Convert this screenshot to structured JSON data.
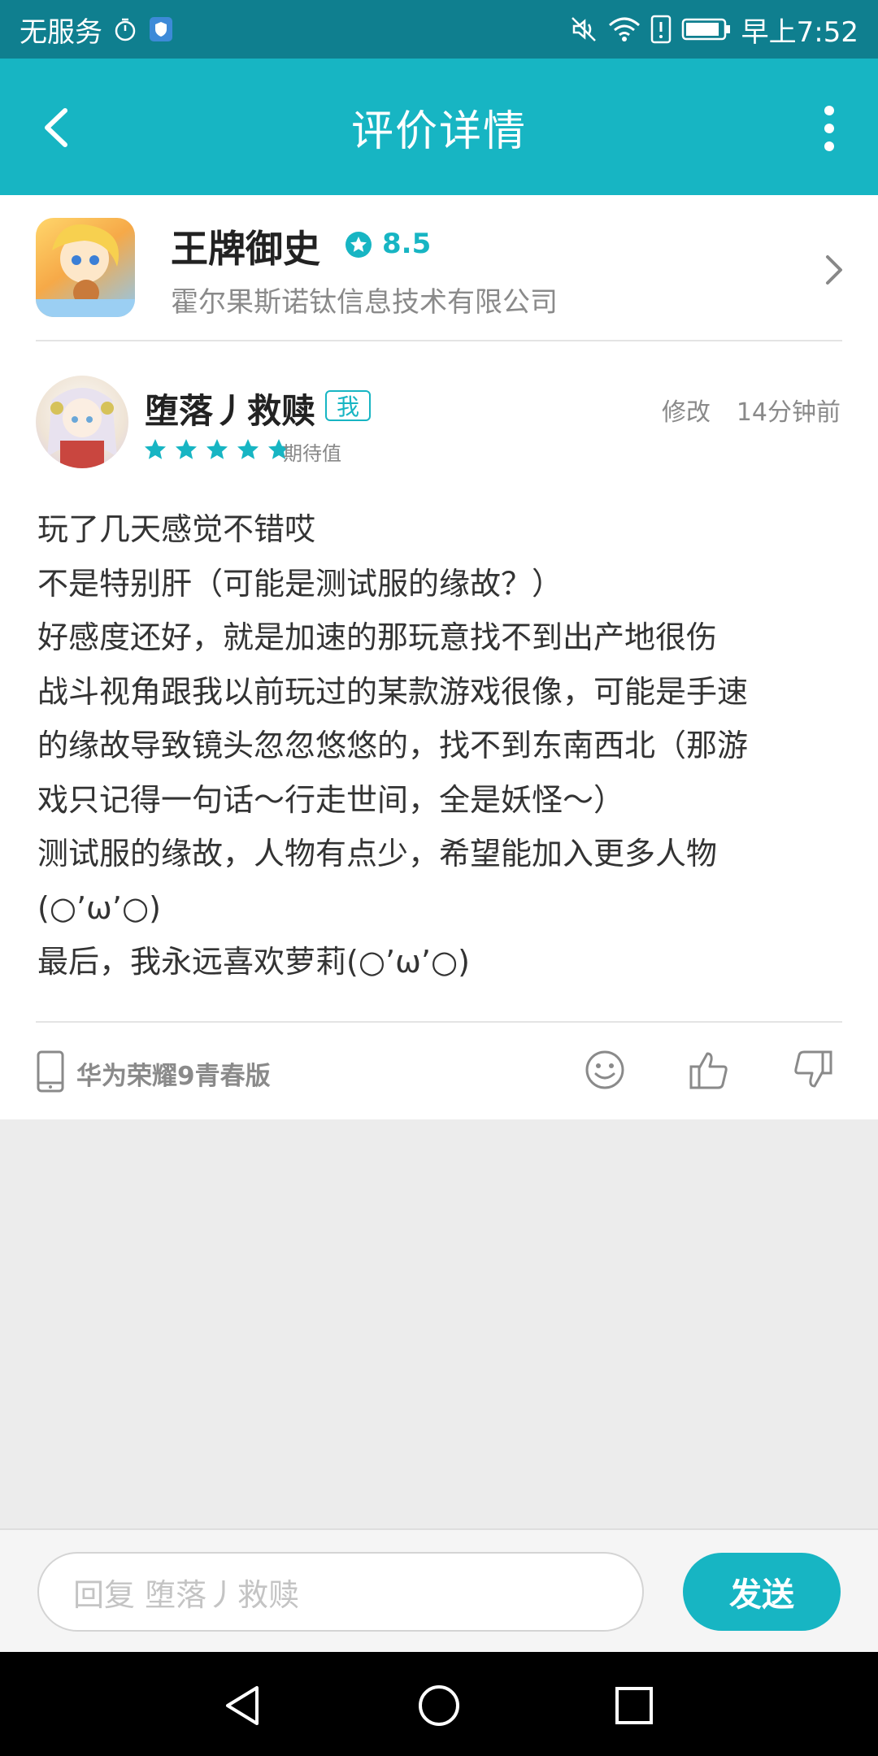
{
  "status_bar": {
    "carrier": "无服务",
    "time": "早上7:52"
  },
  "header": {
    "title": "评价详情"
  },
  "game": {
    "name": "王牌御史",
    "score": "8.5",
    "developer": "霍尔果斯诺钛信息技术有限公司"
  },
  "review": {
    "username": "堕落丿救赎",
    "me_badge": "我",
    "edit_label": "修改",
    "time_ago": "14分钟前",
    "stars": 5,
    "rating_label": "期待值",
    "lines": [
      "玩了几天感觉不错哎",
      "不是特别肝（可能是测试服的缘故？）",
      "好感度还好，就是加速的那玩意找不到出产地很伤",
      "战斗视角跟我以前玩过的某款游戏很像，可能是手速",
      "的缘故导致镜头忽忽悠悠的，找不到东南西北（那游",
      "戏只记得一句话～行走世间，全是妖怪～）",
      "测试服的缘故，人物有点少，希望能加入更多人物",
      "(○’ω’○)",
      "最后，我永远喜欢萝莉(○’ω’○)"
    ],
    "device": "华为荣耀9青春版"
  },
  "reply": {
    "placeholder": "回复 堕落丿救赎",
    "send_label": "发送"
  },
  "colors": {
    "accent": "#17b5c3",
    "status_bar": "#0f7f8f"
  }
}
